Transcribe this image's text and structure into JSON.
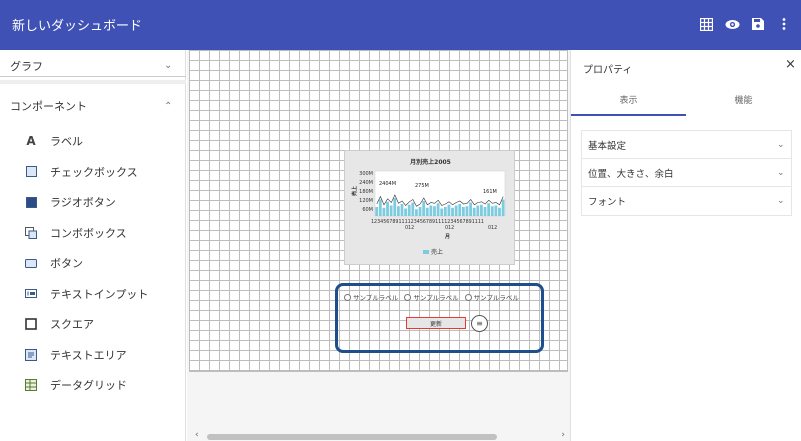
{
  "app": {
    "title": "新しいダッシュボード"
  },
  "toolbar": {
    "icons": [
      "grid-icon",
      "eye-icon",
      "save-icon",
      "more-icon"
    ]
  },
  "left": {
    "graph_label": "グラフ",
    "component_label": "コンポーネント",
    "items": [
      {
        "icon": "A",
        "label": "ラベル"
      },
      {
        "icon": "checkbox",
        "label": "チェックボックス"
      },
      {
        "icon": "radio",
        "label": "ラジオボタン"
      },
      {
        "icon": "combo",
        "label": "コンボボックス"
      },
      {
        "icon": "button",
        "label": "ボタン"
      },
      {
        "icon": "textinput",
        "label": "テキストインプット"
      },
      {
        "icon": "square",
        "label": "スクエア"
      },
      {
        "icon": "textarea",
        "label": "テキストエリア"
      },
      {
        "icon": "datagrid",
        "label": "データグリッド"
      }
    ]
  },
  "canvas": {
    "radios": [
      "サンプルラベル",
      "サンプルラベル",
      "サンプルラベル"
    ],
    "update_label": "更新",
    "menu_label": "≡"
  },
  "right": {
    "title": "プロパティ",
    "close": "×",
    "tabs": [
      "表示",
      "機能"
    ],
    "sections": [
      "基本設定",
      "位置、大きさ、余白",
      "フォント"
    ]
  },
  "chart_data": {
    "type": "bar",
    "title": "月別売上2005",
    "xlabel": "月",
    "ylabel": "売上",
    "ylim": [
      0,
      300
    ],
    "y_ticks": [
      "300M",
      "240M",
      "180M",
      "120M",
      "60M"
    ],
    "x_ticks": [
      "1234567891111234567891111234567891111",
      "012",
      "012",
      "012"
    ],
    "annotations": [
      "2404M",
      "275M",
      "161M"
    ],
    "legend": [
      "売上"
    ],
    "series": [
      {
        "name": "売上",
        "values": [
          60,
          110,
          55,
          95,
          70,
          120,
          65,
          80,
          50,
          75,
          90,
          45,
          60,
          100,
          55,
          70,
          65,
          85,
          50,
          60,
          75,
          55,
          70,
          80,
          60,
          65,
          90,
          55,
          70,
          75,
          60,
          85,
          65,
          70,
          55,
          110
        ]
      }
    ]
  }
}
